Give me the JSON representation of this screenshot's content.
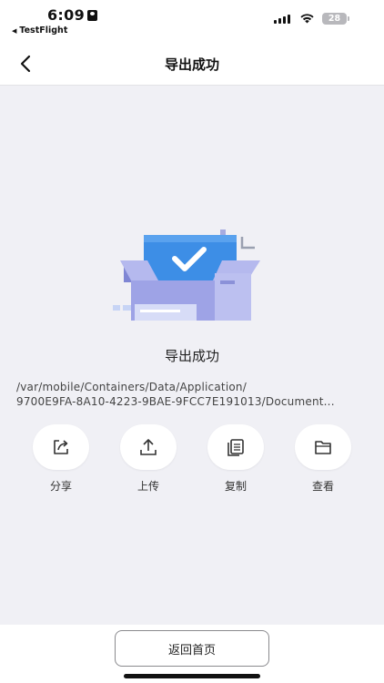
{
  "status_bar": {
    "time": "6:09",
    "back_app": "TestFlight",
    "battery": "28"
  },
  "nav": {
    "title": "导出成功"
  },
  "result": {
    "title": "导出成功",
    "path_line1": "/var/mobile/Containers/Data/Application/",
    "path_line2": "9700E9FA-8A10-4223-9BAE-9FCC7E191013/Document..."
  },
  "actions": [
    {
      "label": "分享",
      "icon": "share-icon"
    },
    {
      "label": "上传",
      "icon": "upload-icon"
    },
    {
      "label": "复制",
      "icon": "copy-icon"
    },
    {
      "label": "查看",
      "icon": "folder-icon"
    }
  ],
  "footer": {
    "home_label": "返回首页"
  },
  "colors": {
    "illustration_blue": "#3d8ee6",
    "illustration_purple": "#8f95dc",
    "background": "#f0f0f5"
  }
}
